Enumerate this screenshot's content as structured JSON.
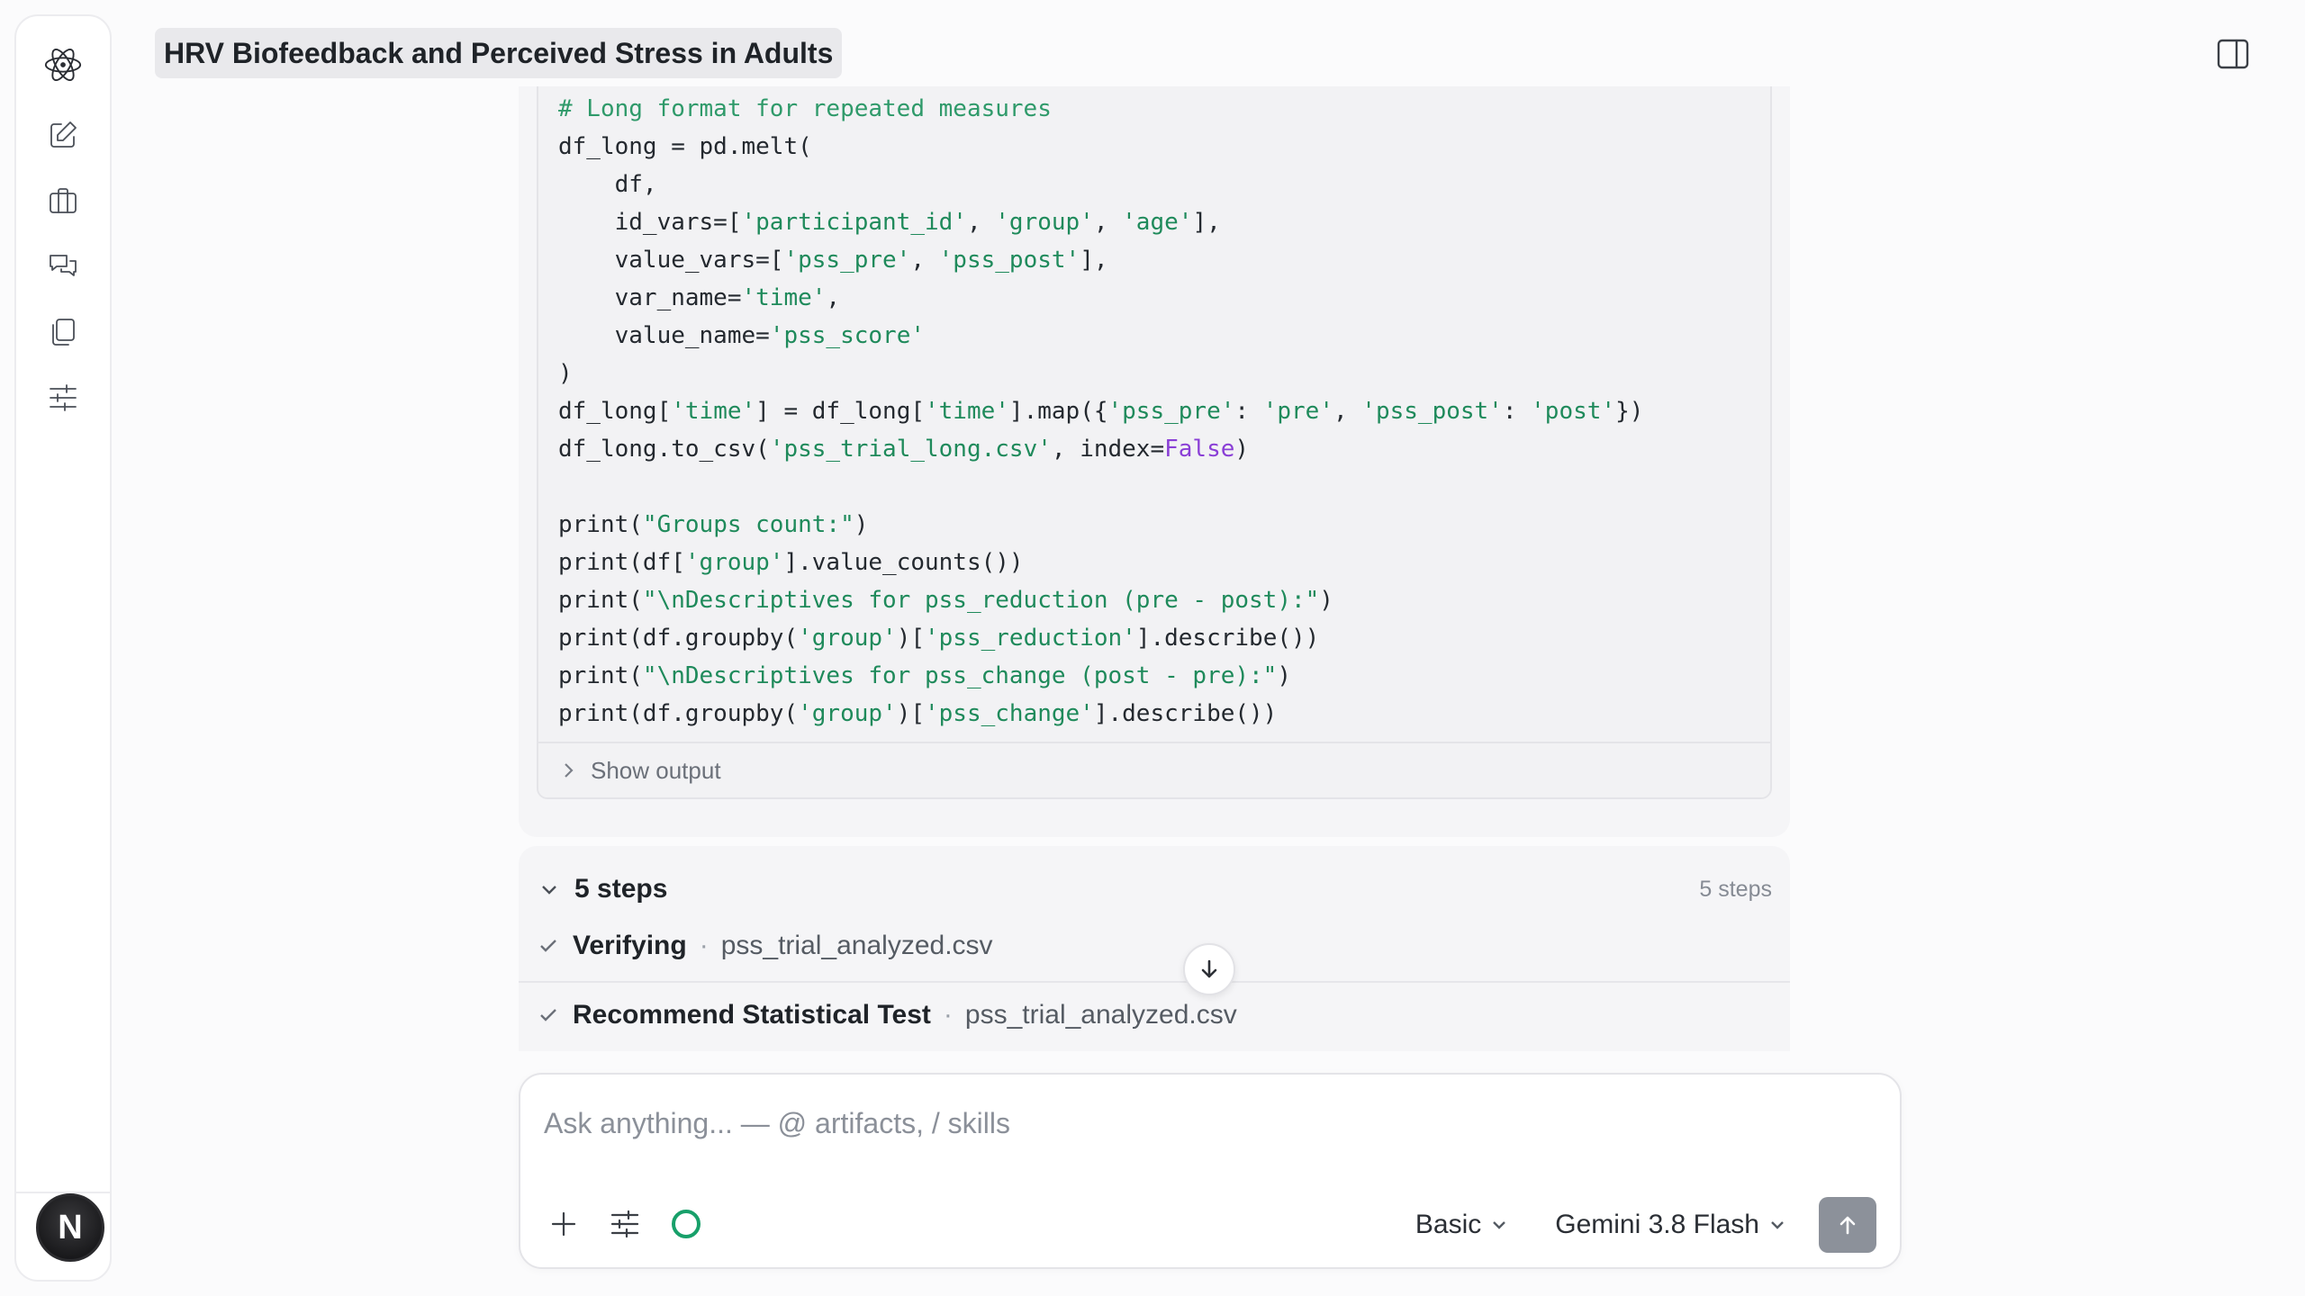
{
  "conversation": {
    "title": "HRV Biofeedback and Perceived Stress in Adults"
  },
  "sidebar": {
    "logo_icon": "atom-icon",
    "items": [
      {
        "name": "new-chat",
        "icon": "edit-icon"
      },
      {
        "name": "projects",
        "icon": "briefcase-icon"
      },
      {
        "name": "chats",
        "icon": "chat-bubbles-icon"
      },
      {
        "name": "artifacts",
        "icon": "copy-icon"
      },
      {
        "name": "settings",
        "icon": "sliders-icon"
      }
    ],
    "avatar_initial": "N"
  },
  "code_block": {
    "lines": [
      [
        {
          "t": "# Long format for repeated measures",
          "c": "com"
        }
      ],
      [
        {
          "t": "df_long = pd.melt("
        }
      ],
      [
        {
          "t": "    df,"
        }
      ],
      [
        {
          "t": "    id_vars=["
        },
        {
          "t": "'participant_id'",
          "c": "str"
        },
        {
          "t": ", "
        },
        {
          "t": "'group'",
          "c": "str"
        },
        {
          "t": ", "
        },
        {
          "t": "'age'",
          "c": "str"
        },
        {
          "t": "],"
        }
      ],
      [
        {
          "t": "    value_vars=["
        },
        {
          "t": "'pss_pre'",
          "c": "str"
        },
        {
          "t": ", "
        },
        {
          "t": "'pss_post'",
          "c": "str"
        },
        {
          "t": "],"
        }
      ],
      [
        {
          "t": "    var_name="
        },
        {
          "t": "'time'",
          "c": "str"
        },
        {
          "t": ","
        }
      ],
      [
        {
          "t": "    value_name="
        },
        {
          "t": "'pss_score'",
          "c": "str"
        }
      ],
      [
        {
          "t": ")"
        }
      ],
      [
        {
          "t": "df_long["
        },
        {
          "t": "'time'",
          "c": "str"
        },
        {
          "t": "] = df_long["
        },
        {
          "t": "'time'",
          "c": "str"
        },
        {
          "t": "].map({"
        },
        {
          "t": "'pss_pre'",
          "c": "str"
        },
        {
          "t": ": "
        },
        {
          "t": "'pre'",
          "c": "str"
        },
        {
          "t": ", "
        },
        {
          "t": "'pss_post'",
          "c": "str"
        },
        {
          "t": ": "
        },
        {
          "t": "'post'",
          "c": "str"
        },
        {
          "t": "})"
        }
      ],
      [
        {
          "t": "df_long.to_csv("
        },
        {
          "t": "'pss_trial_long.csv'",
          "c": "str"
        },
        {
          "t": ", index="
        },
        {
          "t": "False",
          "c": "kw"
        },
        {
          "t": ")"
        }
      ],
      [
        {
          "t": ""
        }
      ],
      [
        {
          "t": "print("
        },
        {
          "t": "\"Groups count:\"",
          "c": "str"
        },
        {
          "t": ")"
        }
      ],
      [
        {
          "t": "print(df["
        },
        {
          "t": "'group'",
          "c": "str"
        },
        {
          "t": "].value_counts())"
        }
      ],
      [
        {
          "t": "print("
        },
        {
          "t": "\"\\nDescriptives for pss_reduction (pre - post):\"",
          "c": "str"
        },
        {
          "t": ")"
        }
      ],
      [
        {
          "t": "print(df.groupby("
        },
        {
          "t": "'group'",
          "c": "str"
        },
        {
          "t": ")["
        },
        {
          "t": "'pss_reduction'",
          "c": "str"
        },
        {
          "t": "].describe())"
        }
      ],
      [
        {
          "t": "print("
        },
        {
          "t": "\"\\nDescriptives for pss_change (post - pre):\"",
          "c": "str"
        },
        {
          "t": ")"
        }
      ],
      [
        {
          "t": "print(df.groupby("
        },
        {
          "t": "'group'",
          "c": "str"
        },
        {
          "t": ")["
        },
        {
          "t": "'pss_change'",
          "c": "str"
        },
        {
          "t": "].describe())"
        }
      ]
    ],
    "show_output_label": "Show output"
  },
  "steps": {
    "title": "5 steps",
    "count_label": "5 steps",
    "items": [
      {
        "name": "Verifying",
        "file": "pss_trial_analyzed.csv"
      },
      {
        "name": "Recommend Statistical Test",
        "file": "pss_trial_analyzed.csv"
      }
    ],
    "separator": "·"
  },
  "composer": {
    "placeholder": "Ask anything... — @ artifacts, / skills",
    "value": "",
    "mode": "Basic",
    "model": "Gemini 3.8 Flash",
    "status_color": "#18a06a"
  }
}
